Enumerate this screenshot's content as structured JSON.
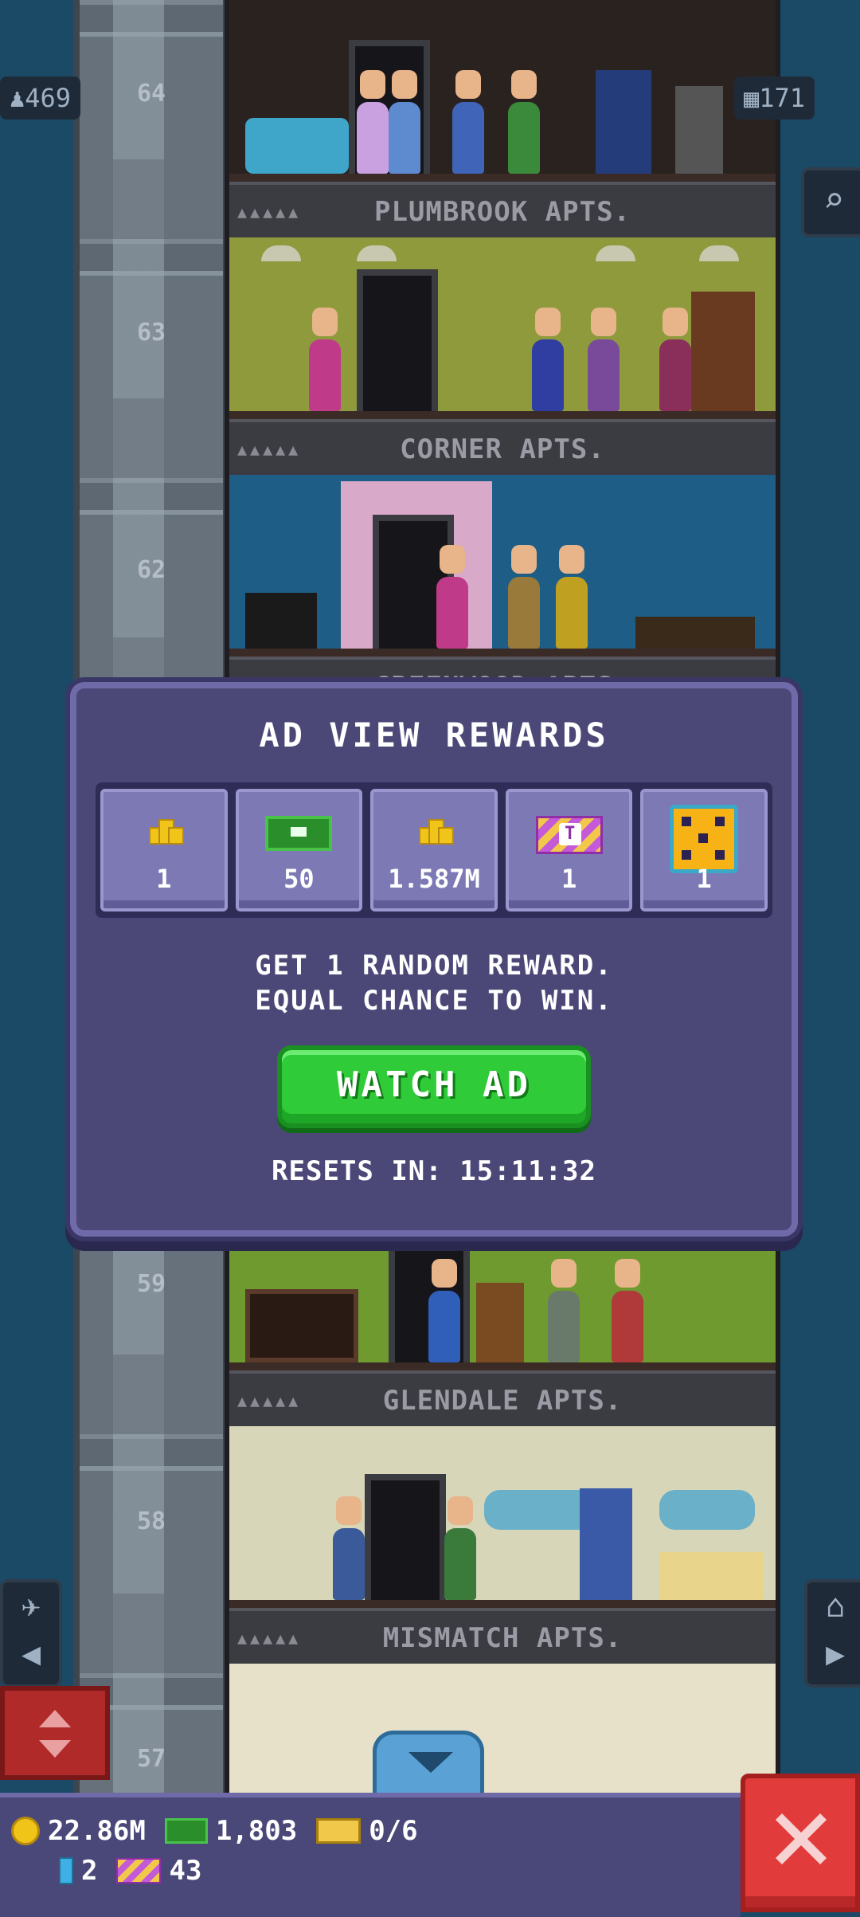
{
  "tower": {
    "population_count": "469",
    "floor_count": "171",
    "floor_numbers": [
      "64",
      "63",
      "62",
      "59",
      "58",
      "57"
    ],
    "rooms": [
      {
        "name": "PLUMBROOK APTS."
      },
      {
        "name": "CORNER APTS."
      },
      {
        "name": "GREENWOOD APTS."
      },
      {
        "name": "GLENDALE APTS."
      },
      {
        "name": "MISMATCH APTS."
      }
    ]
  },
  "modal": {
    "title": "AD VIEW REWARDS",
    "rewards": [
      {
        "icon": "coins-icon",
        "amount": "1"
      },
      {
        "icon": "bux-icon",
        "amount": "50"
      },
      {
        "icon": "coins-icon",
        "amount": "1.587M"
      },
      {
        "icon": "ticket-icon",
        "amount": "1"
      },
      {
        "icon": "dice-icon",
        "amount": "1"
      }
    ],
    "line1": "GET 1 RANDOM REWARD.",
    "line2": "EQUAL CHANCE TO WIN.",
    "watch_button": "WATCH AD",
    "reset_text": "RESETS IN: 15:11:32"
  },
  "hud": {
    "coins": "22.86M",
    "bux": "1,803",
    "golden_tickets": "0/6",
    "bits": "2",
    "tickets": "43"
  },
  "colors": {
    "modal_bg": "#4b4878",
    "watch_button": "#2fcb38",
    "close_button": "#e23b3b"
  }
}
